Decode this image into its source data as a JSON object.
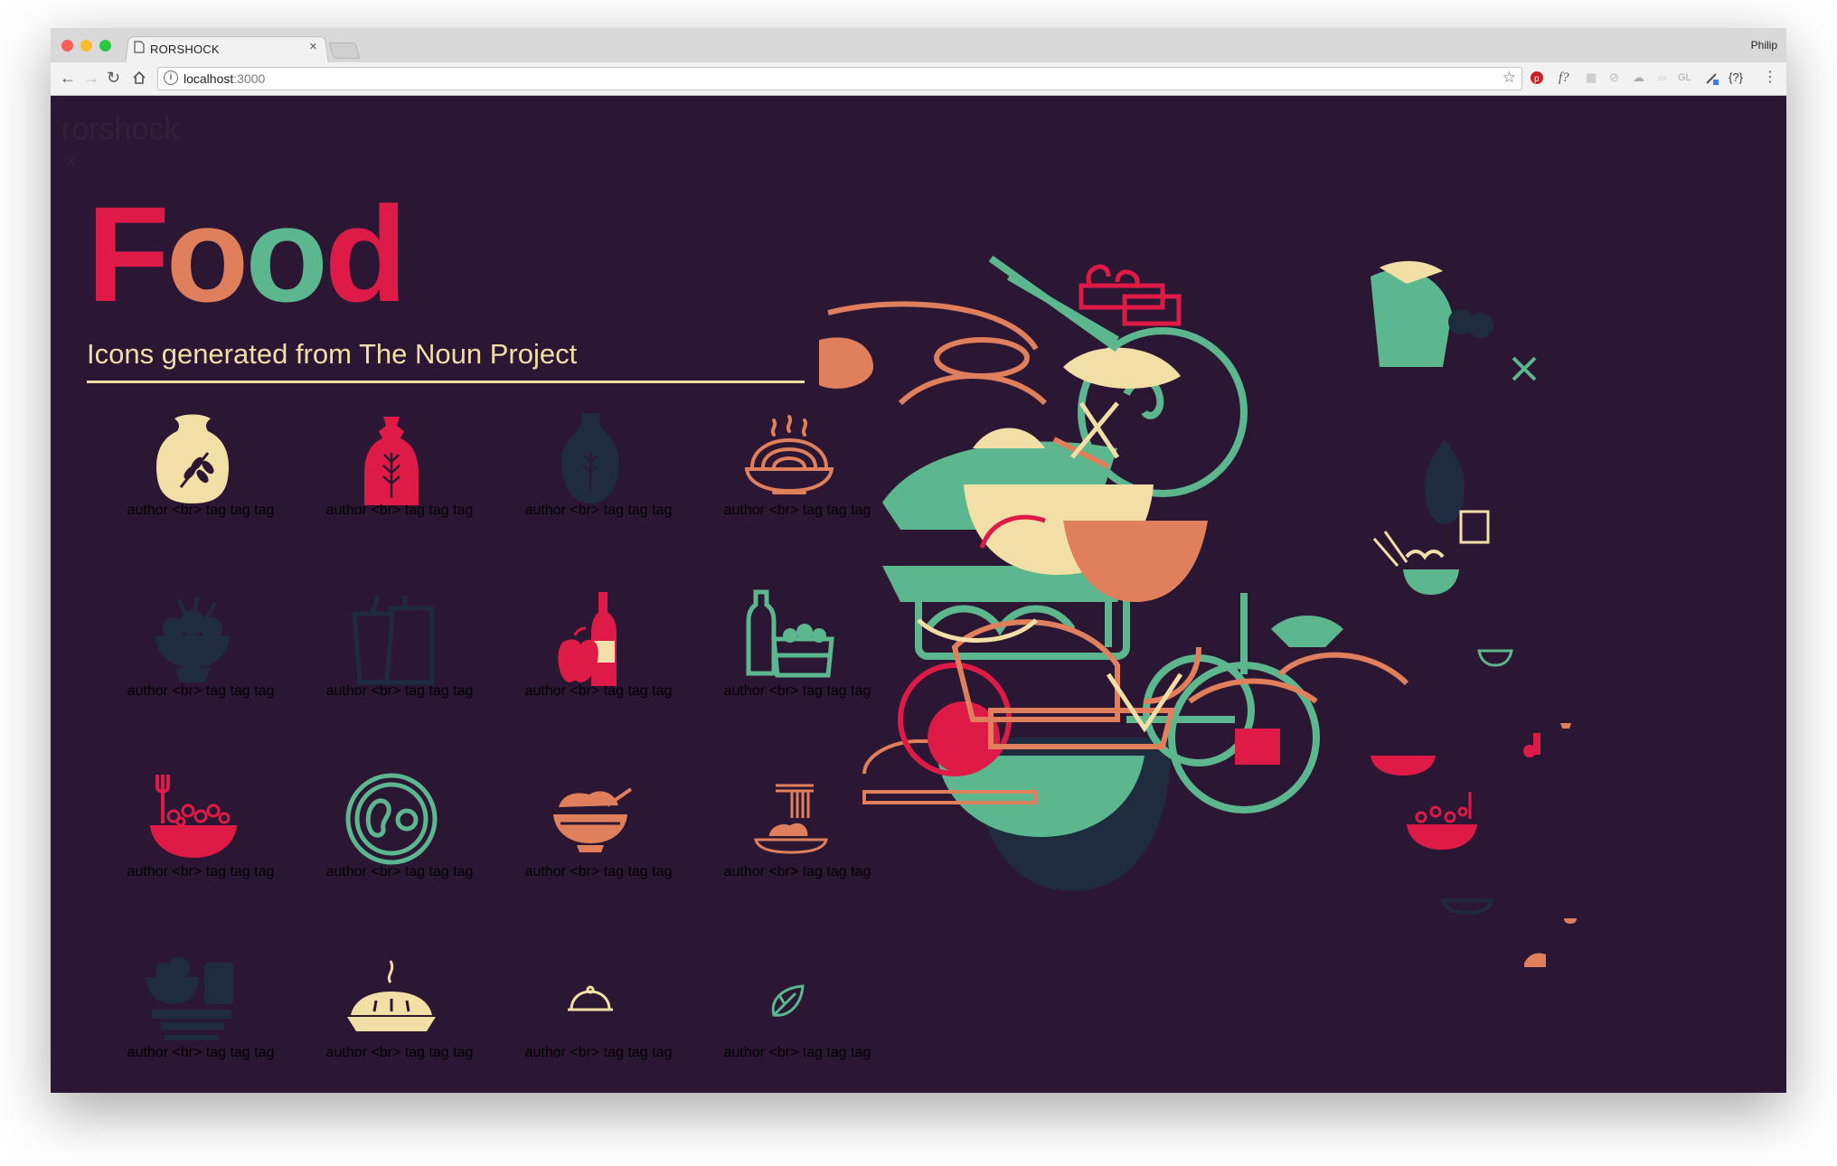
{
  "browser": {
    "tab_title": "RORSHOCK",
    "tab_close": "×",
    "profile_name": "Philip",
    "url_host": "localhost",
    "url_port": ":3000",
    "extensions": [
      "f?",
      "GL",
      "{?}"
    ]
  },
  "page": {
    "brand_ghost": "rorshock",
    "close_ghost": "×",
    "headline": [
      "F",
      "o",
      "o",
      "d"
    ],
    "headline_colors": [
      "#de1b47",
      "#e07f5b",
      "#5cb68e",
      "#de1b47"
    ],
    "subtitle": "Icons generated from The Noun Project"
  },
  "icons": [
    {
      "caption": "author <br> tag tag tag",
      "icon": "grain-sack-icon",
      "color": "#f2dfa6"
    },
    {
      "caption": "author <br> tag tag tag",
      "icon": "wheat-bag-icon",
      "color": "#de1b47"
    },
    {
      "caption": "author <br> tag tag tag",
      "icon": "sake-bottle-icon",
      "color": "#1f2b3f"
    },
    {
      "caption": "author <br> tag tag tag",
      "icon": "noodle-bowl-icon",
      "color": "#e07f5b"
    },
    {
      "caption": "author <br> tag tag tag",
      "icon": "salad-bowl-icon",
      "color": "#1f2b3f"
    },
    {
      "caption": "author <br> tag tag tag",
      "icon": "drink-cups-icon",
      "color": "#1f2b3f"
    },
    {
      "caption": "author <br> tag tag tag",
      "icon": "apple-wine-icon",
      "color": "#de1b47"
    },
    {
      "caption": "author <br> tag tag tag",
      "icon": "picnic-basket-icon",
      "color": "#5cb68e"
    },
    {
      "caption": "author <br> tag tag tag",
      "icon": "berry-bowl-icon",
      "color": "#de1b47"
    },
    {
      "caption": "author <br> tag tag tag",
      "icon": "plate-eggs-icon",
      "color": "#5cb68e"
    },
    {
      "caption": "author <br> tag tag tag",
      "icon": "rice-bowl-icon",
      "color": "#e07f5b"
    },
    {
      "caption": "author <br> tag tag tag",
      "icon": "noodle-plate-icon",
      "color": "#e07f5b"
    },
    {
      "caption": "author <br> tag tag tag",
      "icon": "meal-set-icon",
      "color": "#1f2b3f"
    },
    {
      "caption": "author <br> tag tag tag",
      "icon": "pie-icon",
      "color": "#f2dfa6"
    },
    {
      "caption": "author <br> tag tag tag",
      "icon": "cloche-icon",
      "color": "#f2dfa6"
    },
    {
      "caption": "author <br> tag tag tag",
      "icon": "leaf-icon",
      "color": "#5cb68e"
    }
  ]
}
